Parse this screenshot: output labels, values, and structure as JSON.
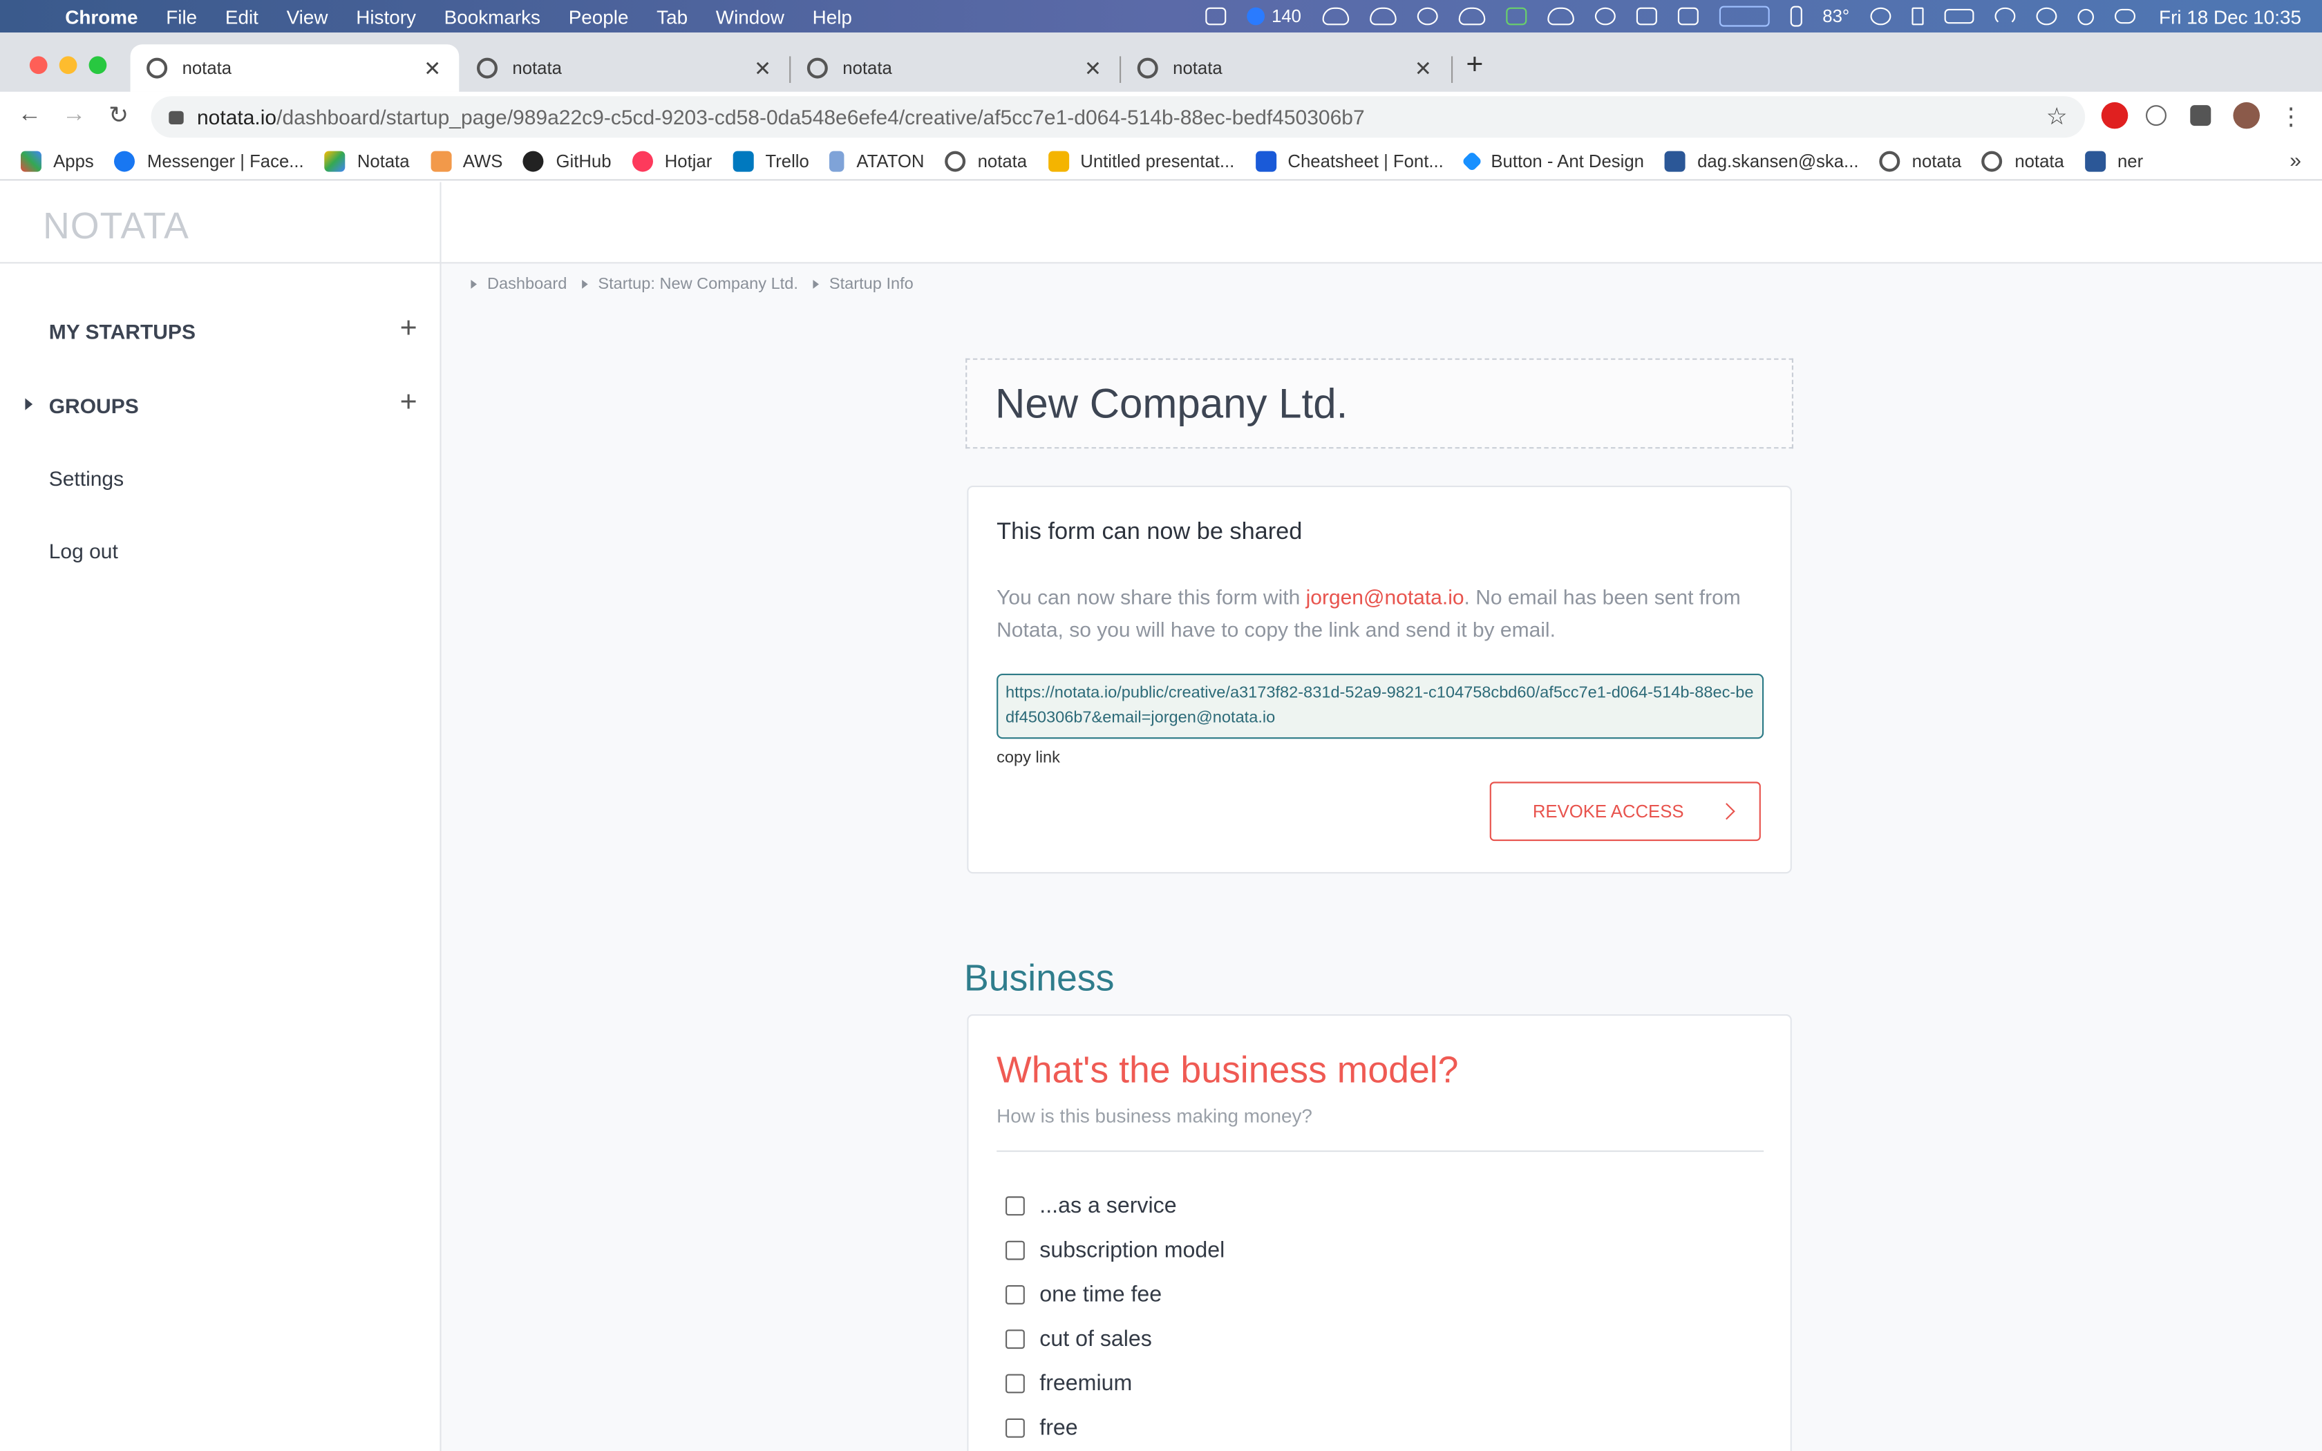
{
  "menubar": {
    "app": "Chrome",
    "items": [
      "File",
      "Edit",
      "View",
      "History",
      "Bookmarks",
      "People",
      "Tab",
      "Window",
      "Help"
    ],
    "status_count": "140",
    "temperature": "83°",
    "clock": "Fri 18 Dec  10:35"
  },
  "tabs": [
    {
      "label": "notata"
    },
    {
      "label": "notata"
    },
    {
      "label": "notata"
    },
    {
      "label": "notata"
    }
  ],
  "address": {
    "host": "notata.io",
    "path": "/dashboard/startup_page/989a22c9-c5cd-9203-cd58-0da548e6efe4/creative/af5cc7e1-d064-514b-88ec-bedf450306b7"
  },
  "bookmarks": [
    {
      "label": "Apps",
      "color": "#e44b3f"
    },
    {
      "label": "Messenger | Face...",
      "color": "#1877f2"
    },
    {
      "label": "Notata",
      "color": "#34a853"
    },
    {
      "label": "AWS",
      "color": "#f2994a"
    },
    {
      "label": "GitHub",
      "color": "#222222"
    },
    {
      "label": "Hotjar",
      "color": "#fd3a5c"
    },
    {
      "label": "Trello",
      "color": "#0079bf"
    },
    {
      "label": "ATATON",
      "color": "#7fa3d8"
    },
    {
      "label": "notata",
      "color": "#555555"
    },
    {
      "label": "Untitled presentat...",
      "color": "#f4b400"
    },
    {
      "label": "Cheatsheet | Font...",
      "color": "#1a5ad8"
    },
    {
      "label": "Button - Ant Design",
      "color": "#1890ff"
    },
    {
      "label": "dag.skansen@ska...",
      "color": "#2b5797"
    },
    {
      "label": "notata",
      "color": "#555555"
    },
    {
      "label": "notata",
      "color": "#555555"
    },
    {
      "label": "ner",
      "color": "#2b5797"
    }
  ],
  "bookmarks_more": "»",
  "app": {
    "logo": "NOTATA",
    "sidebar": {
      "my_startups": "MY STARTUPS",
      "groups": "GROUPS",
      "settings": "Settings",
      "logout": "Log out"
    },
    "breadcrumbs": [
      "Dashboard",
      "Startup: New Company Ltd.",
      "Startup Info"
    ],
    "company_name": "New Company Ltd.",
    "share": {
      "title": "This form can now be shared",
      "desc_before": "You can now share this form with ",
      "email": "jorgen@notata.io",
      "desc_after": ". No email has been sent from Notata, so you will have to copy the link and send it by email.",
      "link": "https://notata.io/public/creative/a3173f82-831d-52a9-9821-c104758cbd60/af5cc7e1-d064-514b-88ec-bedf450306b7&email=jorgen@notata.io",
      "copy_label": "copy link",
      "revoke_label": "REVOKE ACCESS"
    },
    "section_title": "Business",
    "question": {
      "title": "What's the business model?",
      "subtitle": "How is this business making money?",
      "options": [
        "...as a service",
        "subscription model",
        "one time fee",
        "cut of sales",
        "freemium",
        "free"
      ]
    }
  },
  "colors": {
    "accent_red": "#ef5a53",
    "accent_teal": "#2f7d8c"
  }
}
